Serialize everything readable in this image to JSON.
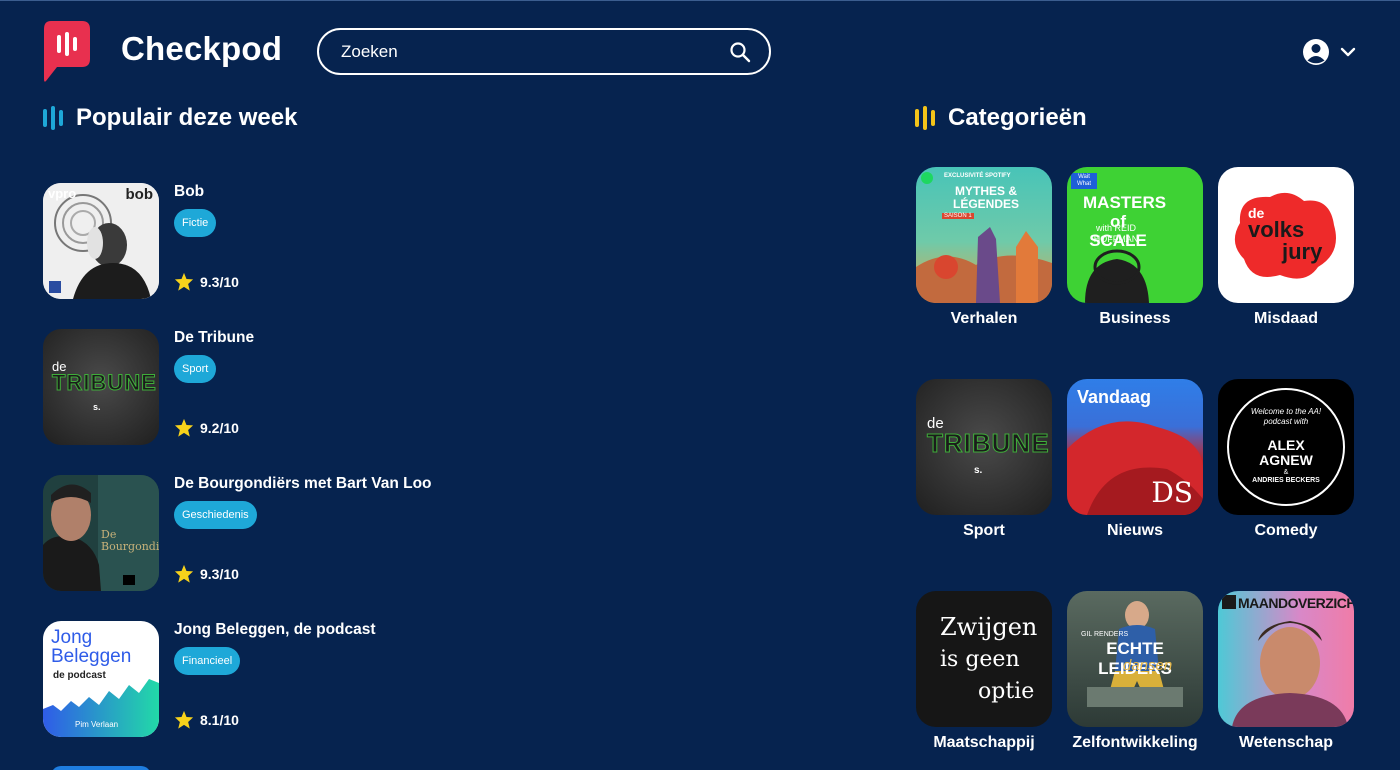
{
  "app": {
    "name": "Checkpod"
  },
  "search": {
    "placeholder": "Zoeken"
  },
  "colors": {
    "background": "#06234f",
    "accent_blue": "#1ea8d8",
    "accent_yellow": "#f4c419",
    "logo_red": "#e8304f",
    "star": "#f7d21b"
  },
  "popular": {
    "heading": "Populair deze week",
    "items": [
      {
        "title": "Bob",
        "genre": "Fictie",
        "rating": "9.3/10",
        "cover_text": "bob",
        "cover_brand": "vpro"
      },
      {
        "title": "De Tribune",
        "genre": "Sport",
        "rating": "9.2/10",
        "cover_text": "TRIBUNE"
      },
      {
        "title": "De Bourgondiërs met Bart Van Loo",
        "genre": "Geschiedenis",
        "rating": "9.3/10",
        "cover_text": "De Bourgondiërs"
      },
      {
        "title": "Jong Beleggen, de podcast",
        "genre": "Financieel",
        "rating": "8.1/10",
        "cover_line1": "Jong",
        "cover_line2": "Beleggen",
        "cover_sub": "de podcast",
        "cover_author": "Pim Verlaan"
      }
    ]
  },
  "categories": {
    "heading": "Categorieën",
    "items": [
      {
        "label": "Verhalen",
        "cover_top": "EXCLUSIVITÉ SPOTIFY",
        "cover_title": "MYTHES & LÉGENDES",
        "cover_season": "SAISON 1"
      },
      {
        "label": "Business",
        "cover_title": "MASTERS of SCALE",
        "cover_sub": "with REID HOFFMAN",
        "cover_badge": "Wait What"
      },
      {
        "label": "Misdaad",
        "cover_line1": "de",
        "cover_line2": "volks",
        "cover_line3": "jury"
      },
      {
        "label": "Sport",
        "cover_text": "TRIBUNE"
      },
      {
        "label": "Nieuws",
        "cover_title": "Vandaag",
        "cover_mark": "DS"
      },
      {
        "label": "Comedy",
        "cover_welcome": "Welcome to the AA! podcast with",
        "cover_name1": "ALEX",
        "cover_name2": "AGNEW",
        "cover_and": "&",
        "cover_name3": "ANDRIES BECKERS"
      },
      {
        "label": "Maatschappij",
        "cover_line1": "Zwijgen",
        "cover_line2": "is geen",
        "cover_line3": "optie"
      },
      {
        "label": "Zelfontwikkeling",
        "cover_top": "GIL RENDERS",
        "cover_title": "ECHTE LEIDERS",
        "cover_script": "dansen"
      },
      {
        "label": "Wetenschap",
        "cover_title": "MAANDOVERZICHT"
      }
    ]
  }
}
